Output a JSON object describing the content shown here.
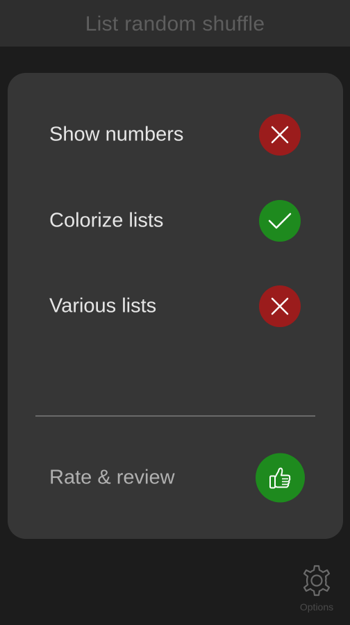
{
  "header": {
    "title": "List random shuffle"
  },
  "settings": {
    "items": [
      {
        "label": "Show numbers",
        "state": "off",
        "icon": "x-icon"
      },
      {
        "label": "Colorize lists",
        "state": "on",
        "icon": "check-icon"
      },
      {
        "label": "Various lists",
        "state": "off",
        "icon": "x-icon"
      }
    ],
    "rate": {
      "label": "Rate & review",
      "icon": "thumbs-up-icon"
    }
  },
  "footer": {
    "options_label": "Options",
    "options_icon": "gear-icon"
  },
  "colors": {
    "off": "#9b1c1c",
    "on": "#1e8a1e",
    "panel": "#363636",
    "background": "#1c1c1c",
    "topbar": "#2e2e2e"
  }
}
